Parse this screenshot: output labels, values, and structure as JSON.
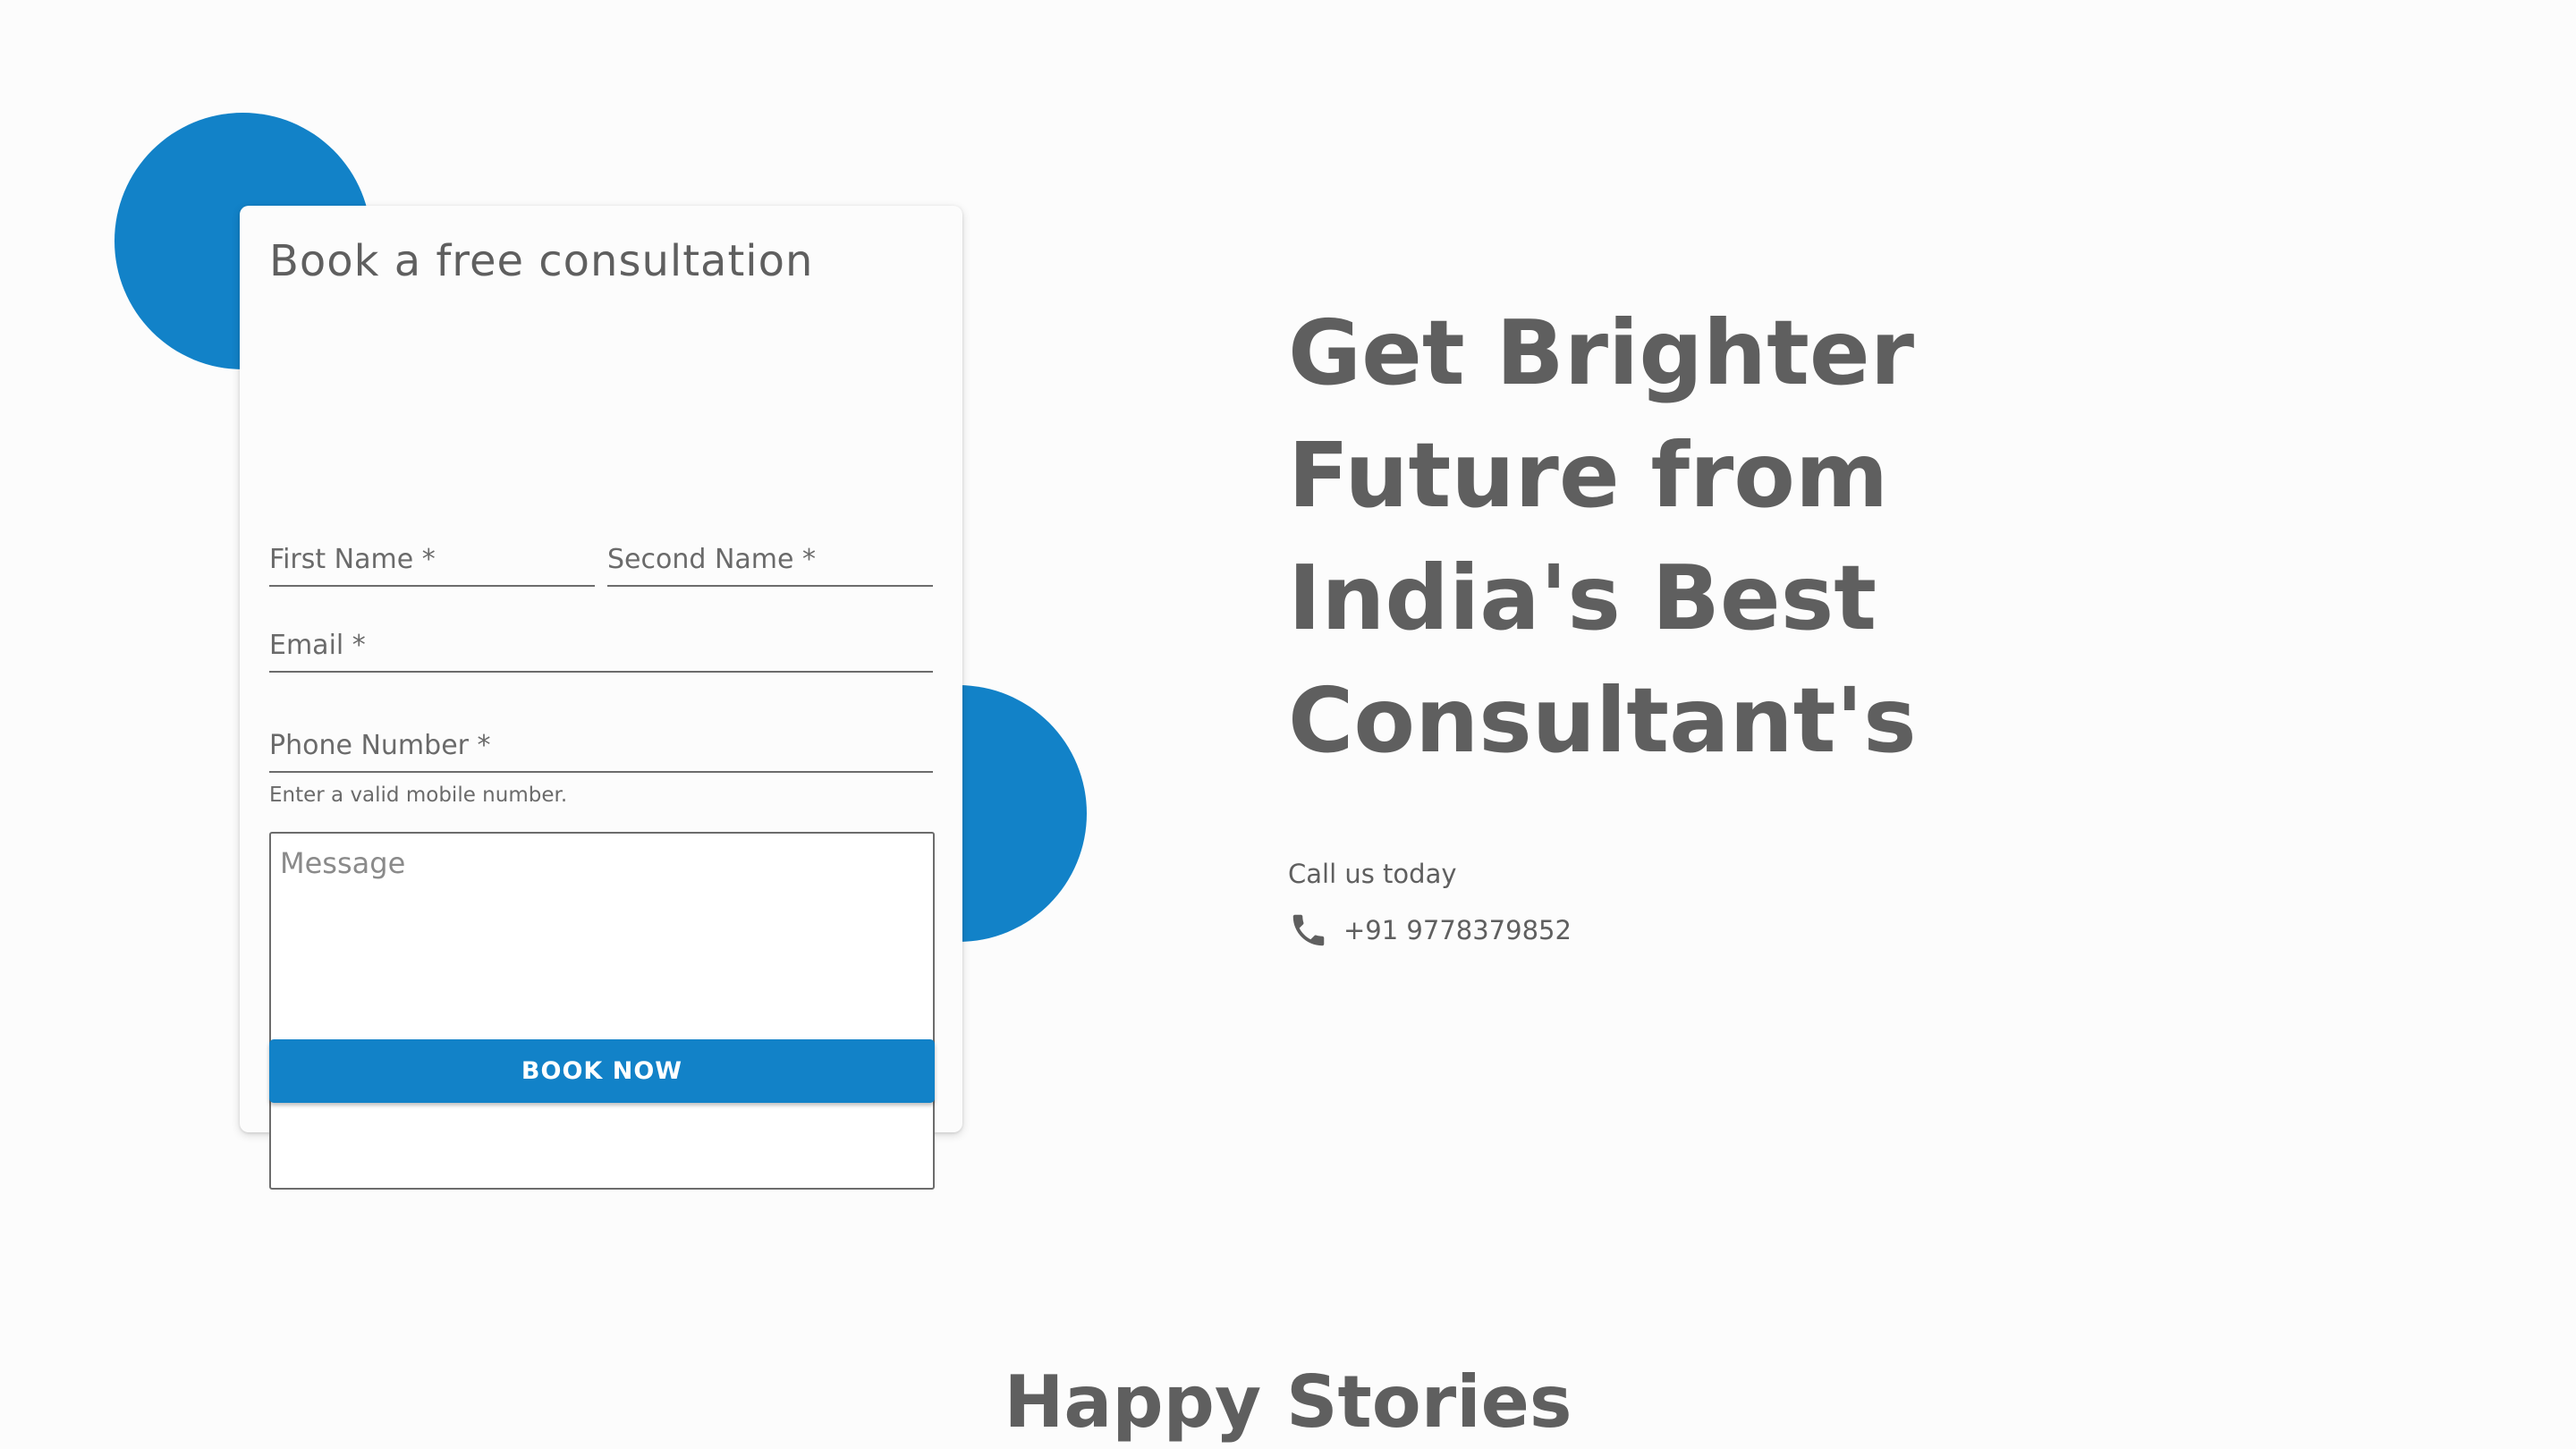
{
  "colors": {
    "accent": "#1282c8",
    "text": "#5f5f5f",
    "background": "#fcfcfc"
  },
  "form": {
    "title": "Book a free consultation",
    "first_name_label": "First Name *",
    "second_name_label": "Second Name *",
    "email_label": "Email *",
    "phone_label": "Phone Number *",
    "phone_hint": "Enter a valid mobile number.",
    "message_placeholder": "Message",
    "submit_label": "BOOK NOW"
  },
  "hero": {
    "lines": [
      "Get Brighter",
      "Future from",
      "India's Best",
      "Consultant's"
    ]
  },
  "contact": {
    "call_label": "Call us today",
    "phone_icon": "phone-icon",
    "phone_number": "+91 9778379852"
  },
  "section": {
    "title": "Happy Stories"
  }
}
